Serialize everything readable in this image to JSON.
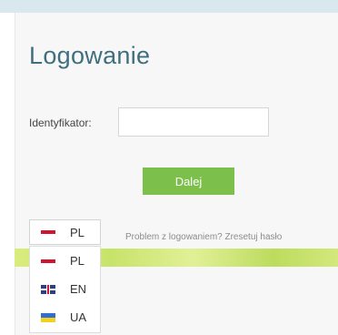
{
  "login": {
    "title": "Logowanie",
    "identifier_label": "Identyfikator:",
    "identifier_value": "",
    "identifier_placeholder": "",
    "next_label": "Dalej",
    "reset_link": "Problem z logowaniem? Zresetuj hasło"
  },
  "language": {
    "selected": "PL",
    "options": [
      {
        "code": "PL",
        "icon": "flag-pl-icon"
      },
      {
        "code": "EN",
        "icon": "flag-uk-icon"
      },
      {
        "code": "UA",
        "icon": "flag-ua-icon"
      }
    ]
  },
  "colors": {
    "title": "#3f6f7f",
    "button": "#7cc04b"
  }
}
